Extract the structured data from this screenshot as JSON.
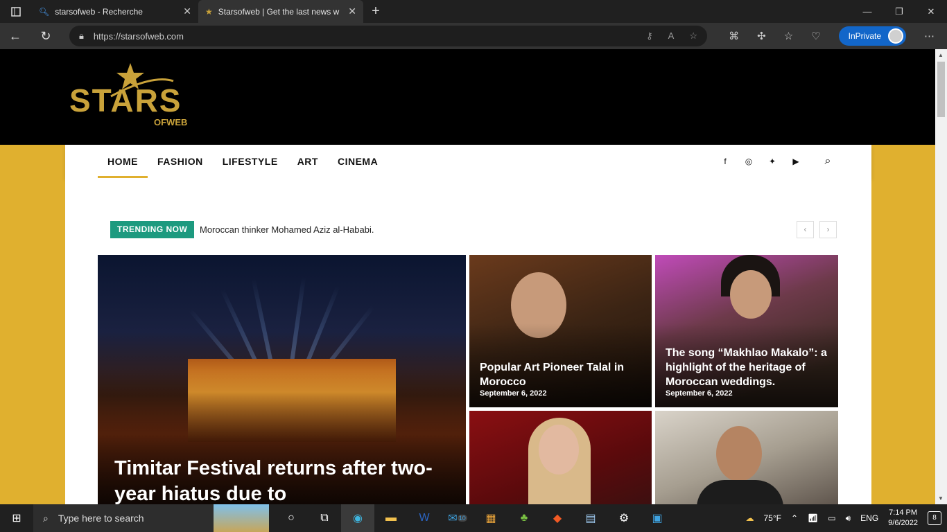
{
  "browser": {
    "tabs": [
      {
        "title": "starsofweb - Recherche"
      },
      {
        "title": "Starsofweb | Get the last news w"
      }
    ],
    "url": "https://starsofweb.com",
    "inprivate_label": "InPrivate"
  },
  "site": {
    "logo_text": "STARS",
    "logo_sub": "OFWEB",
    "menu": [
      "HOME",
      "FASHION",
      "LIFESTYLE",
      "ART",
      "CINEMA"
    ],
    "social_icons": [
      "facebook-icon",
      "instagram-icon",
      "twitter-icon",
      "youtube-icon"
    ],
    "trending_label": "TRENDING NOW",
    "trending_text": "Moroccan thinker Mohamed Aziz al-Hababi.",
    "accent_color": "#e0b02f",
    "trending_color": "#1d9a7f"
  },
  "featured": {
    "title": "Timitar Festival returns after two-year hiatus due to"
  },
  "cards": [
    {
      "title": "Popular Art Pioneer Talal in Morocco",
      "date": "September 6, 2022"
    },
    {
      "title": "The song “Makhlao Makalo”: a highlight of the heritage of Moroccan weddings.",
      "date": "September 6, 2022"
    }
  ],
  "taskbar": {
    "search_placeholder": "Type here to search",
    "mail_badge": "10",
    "weather": "75°F",
    "language": "ENG",
    "time": "7:14 PM",
    "date": "9/6/2022",
    "notifications": "8"
  }
}
